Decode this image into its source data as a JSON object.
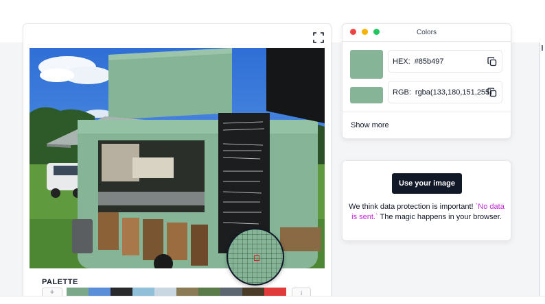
{
  "preview": {
    "fullscreen_icon": "fullscreen-icon",
    "magnifier_color": "#85b497"
  },
  "palette": {
    "title": "PALETTE",
    "add_label": "+",
    "download_label": "↓",
    "swatches": [
      "#7aa889",
      "#5a8ed8",
      "#27292b",
      "#8fbfd9",
      "#c9d7e3",
      "#8a7a55",
      "#5b7a4a",
      "#5c6670",
      "#4a3a28",
      "#e03a3a"
    ]
  },
  "colors_window": {
    "title": "Colors",
    "swatch_color": "#85b497",
    "hex_label": "HEX:",
    "hex_value": "#85b497",
    "rgb_label": "RGB:",
    "rgb_value": "rgba(133,180,151,255)",
    "show_more": "Show more"
  },
  "upload": {
    "button_label": "Use your image",
    "privacy_prefix": "We think data protection is important! ",
    "privacy_highlight": "`No data is sent.`",
    "privacy_suffix": " The magic happens in your browser."
  }
}
